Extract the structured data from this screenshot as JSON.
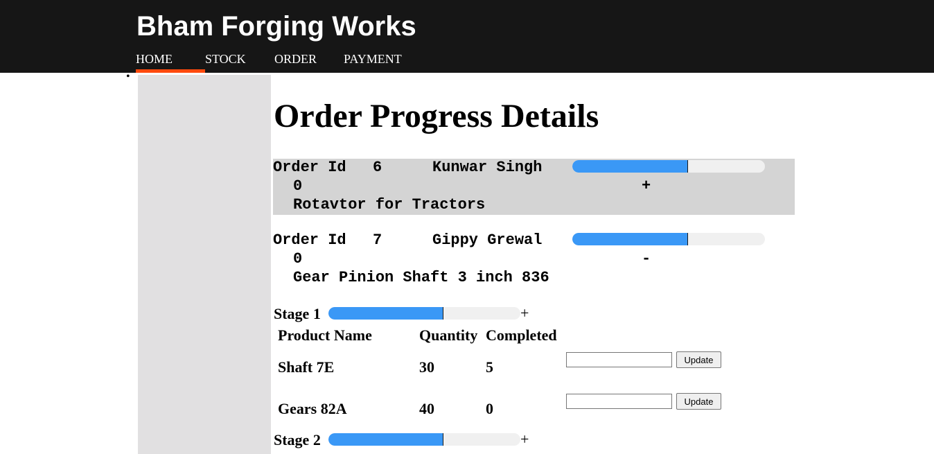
{
  "header": {
    "brand": "Bham Forging Works",
    "nav": [
      "HOME",
      "STOCK",
      "ORDER",
      "PAYMENT"
    ],
    "active_nav": "HOME",
    "accent_color": "#ff4a0d"
  },
  "bullet": "•",
  "page_title": "Order Progress Details",
  "orders": [
    {
      "id_label": "Order Id",
      "id": "6",
      "customer": "Kunwar Singh",
      "progress": 0.6,
      "count": "0",
      "toggle": "+",
      "product": "Rotavtor for Tractors",
      "selected": true
    },
    {
      "id_label": "Order Id",
      "id": "7",
      "customer": "Gippy Grewal",
      "progress": 0.6,
      "count": "0",
      "toggle": "-",
      "product": "Gear Pinion Shaft 3 inch 836",
      "selected": false
    }
  ],
  "stages": [
    {
      "label": "Stage 1",
      "progress": 0.6,
      "toggle": "+",
      "table": {
        "headers": [
          "Product Name",
          "Quantity",
          "Completed"
        ],
        "rows": [
          {
            "product": "Shaft 7E",
            "quantity": "30",
            "completed": "5",
            "input_value": "",
            "button": "Update"
          },
          {
            "product": "Gears 82A",
            "quantity": "40",
            "completed": "0",
            "input_value": "",
            "button": "Update"
          }
        ]
      }
    },
    {
      "label": "Stage 2",
      "progress": 0.6,
      "toggle": "+"
    }
  ],
  "colors": {
    "progress_fill": "#3a98f6",
    "progress_track": "#f0f0f0",
    "selected_order_bg": "#d4d4d4",
    "sidebar_bg": "#e1e0e1",
    "header_bg": "#161616"
  }
}
